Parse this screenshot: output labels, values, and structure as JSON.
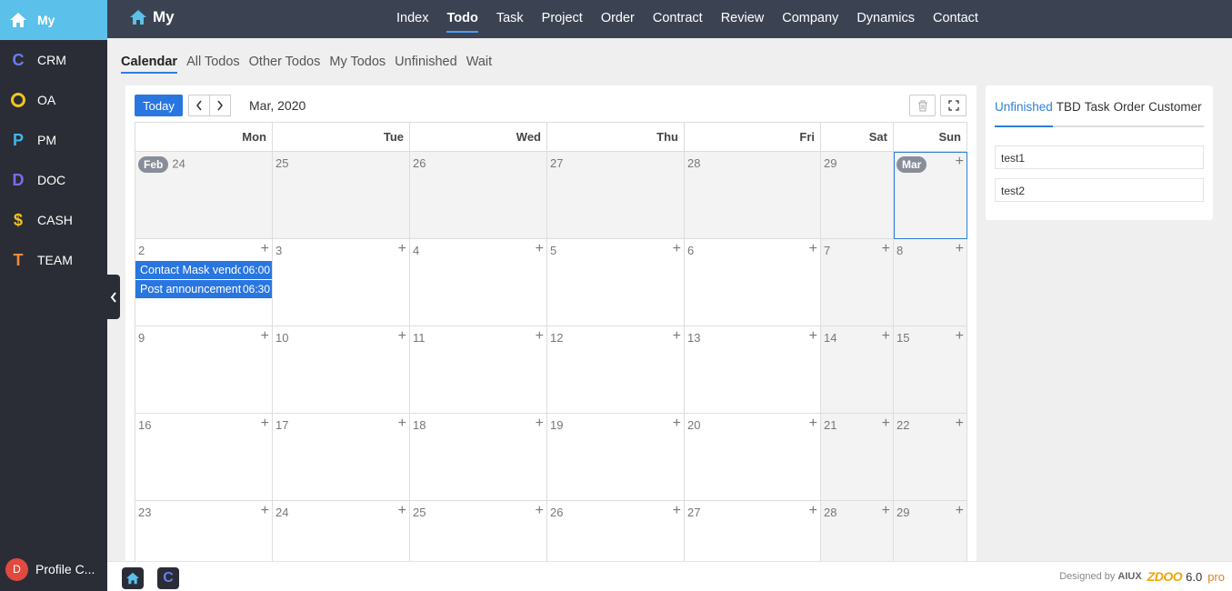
{
  "sidebar": {
    "apps": [
      {
        "label": "My",
        "icon": "home-icon",
        "glyph": "",
        "color": "#ffffff",
        "active": true
      },
      {
        "label": "CRM",
        "icon": "crm-icon",
        "glyph": "C",
        "color": "#6a7cf2",
        "active": false
      },
      {
        "label": "OA",
        "icon": "oa-icon",
        "glyph": "O",
        "color": "#f0c420",
        "active": false
      },
      {
        "label": "PM",
        "icon": "pm-icon",
        "glyph": "P",
        "color": "#3fb7e8",
        "active": false
      },
      {
        "label": "DOC",
        "icon": "doc-icon",
        "glyph": "D",
        "color": "#7c6bea",
        "active": false
      },
      {
        "label": "CASH",
        "icon": "cash-icon",
        "glyph": "$",
        "color": "#f0c420",
        "active": false
      },
      {
        "label": "TEAM",
        "icon": "team-icon",
        "glyph": "T",
        "color": "#f08a3c",
        "active": false
      }
    ],
    "profile": {
      "initial": "D",
      "label": "Profile C..."
    }
  },
  "topbar": {
    "title": "My",
    "nav": [
      "Index",
      "Todo",
      "Task",
      "Project",
      "Order",
      "Contract",
      "Review",
      "Company",
      "Dynamics",
      "Contact"
    ],
    "active_nav": "Todo"
  },
  "subtabs": {
    "items": [
      "Calendar",
      "All Todos",
      "Other Todos",
      "My Todos",
      "Unfinished",
      "Wait"
    ],
    "active": "Calendar"
  },
  "calendar": {
    "today_label": "Today",
    "month_label": "Mar, 2020",
    "weekdays": [
      "Mon",
      "Tue",
      "Wed",
      "Thu",
      "Fri",
      "Sat",
      "Sun"
    ],
    "weeks": [
      [
        {
          "day": "24",
          "month_pill": "Feb",
          "other": true
        },
        {
          "day": "25",
          "other": true
        },
        {
          "day": "26",
          "other": true
        },
        {
          "day": "27",
          "other": true
        },
        {
          "day": "28",
          "other": true
        },
        {
          "day": "29",
          "other": true
        },
        {
          "day": "",
          "month_pill": "Mar",
          "today": true
        }
      ],
      [
        {
          "day": "2",
          "events": [
            {
              "title": "Contact Mask vendors",
              "time": "06:00"
            },
            {
              "title": "Post announcement",
              "time": "06:30"
            }
          ]
        },
        {
          "day": "3"
        },
        {
          "day": "4"
        },
        {
          "day": "5"
        },
        {
          "day": "6"
        },
        {
          "day": "7"
        },
        {
          "day": "8"
        }
      ],
      [
        {
          "day": "9"
        },
        {
          "day": "10"
        },
        {
          "day": "11"
        },
        {
          "day": "12"
        },
        {
          "day": "13"
        },
        {
          "day": "14"
        },
        {
          "day": "15"
        }
      ],
      [
        {
          "day": "16"
        },
        {
          "day": "17"
        },
        {
          "day": "18"
        },
        {
          "day": "19"
        },
        {
          "day": "20"
        },
        {
          "day": "21"
        },
        {
          "day": "22"
        }
      ],
      [
        {
          "day": "23"
        },
        {
          "day": "24"
        },
        {
          "day": "25"
        },
        {
          "day": "26"
        },
        {
          "day": "27"
        },
        {
          "day": "28"
        },
        {
          "day": "29"
        }
      ]
    ]
  },
  "right_panel": {
    "tabs": [
      "Unfinished",
      "TBD",
      "Task",
      "Order",
      "Customer"
    ],
    "active_tab": "Unfinished",
    "items": [
      "test1",
      "test2"
    ]
  },
  "footer": {
    "designed_by": "Designed by",
    "designer": "AIUX",
    "logo": "ZDOO",
    "version": "6.0",
    "edition": "pro"
  },
  "colors": {
    "accent": "#2a76e0",
    "sidebar_active": "#5bc0ea",
    "topbar": "#3b4352",
    "sidebar": "#2a2d35"
  }
}
